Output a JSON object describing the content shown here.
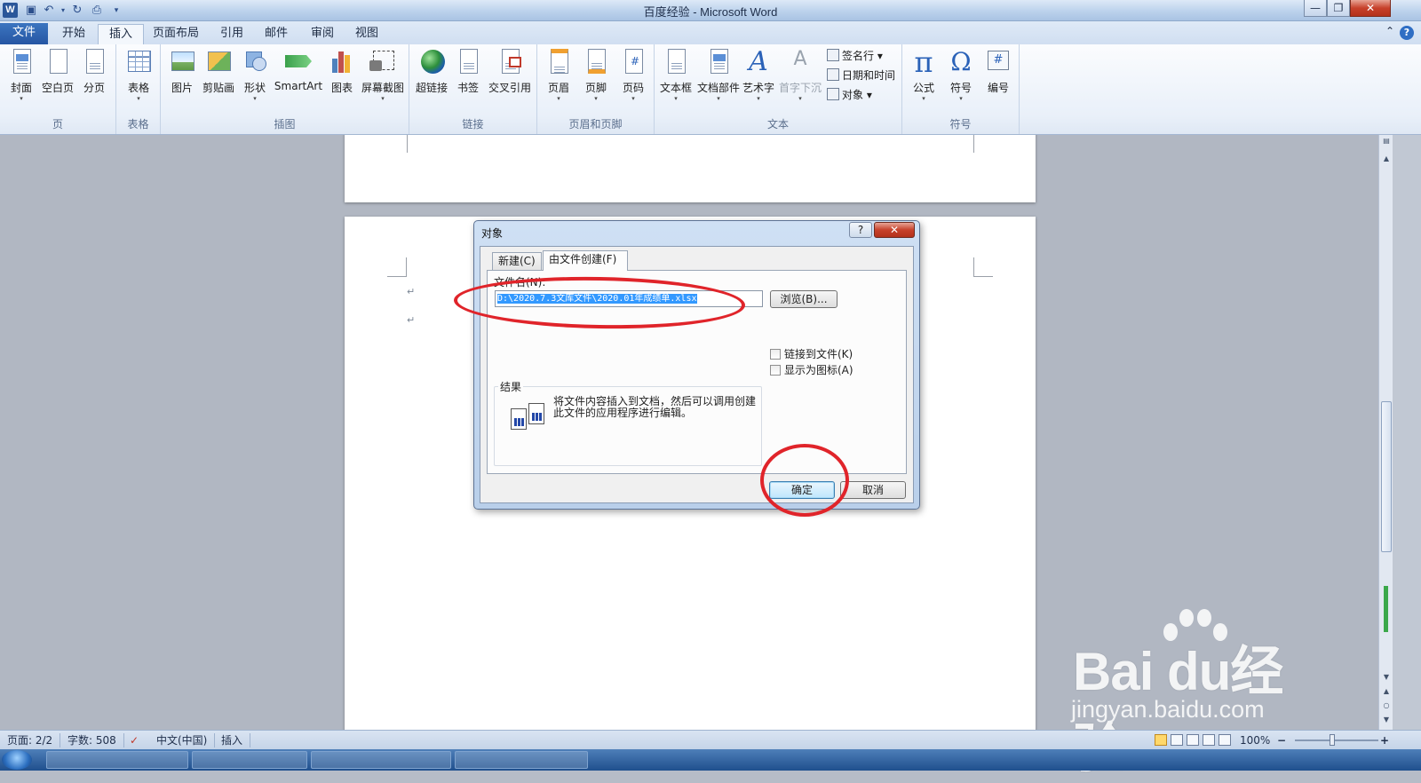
{
  "window": {
    "title": "百度经验 - Microsoft Word",
    "minimize_glyph": "—",
    "maximize_glyph": "❐",
    "close_glyph": "✕",
    "quick_access": {
      "save_icon": "save-icon",
      "undo_icon": "undo-icon",
      "redo_icon": "redo-icon",
      "print_preview_icon": "print-preview-icon",
      "customize_icon": "customize-icon"
    }
  },
  "tabs": [
    {
      "label": "文件"
    },
    {
      "label": "开始"
    },
    {
      "label": "插入"
    },
    {
      "label": "页面布局"
    },
    {
      "label": "引用"
    },
    {
      "label": "邮件"
    },
    {
      "label": "审阅"
    },
    {
      "label": "视图"
    }
  ],
  "tab_help_glyph": "?",
  "tab_minimize_glyph": "⌃",
  "ribbon": {
    "groups": [
      {
        "label": "页",
        "items": [
          "封面",
          "空白页",
          "分页"
        ]
      },
      {
        "label": "表格",
        "items": [
          "表格"
        ]
      },
      {
        "label": "插图",
        "items": [
          "图片",
          "剪贴画",
          "形状",
          "SmartArt",
          "图表",
          "屏幕截图"
        ]
      },
      {
        "label": "链接",
        "items": [
          "超链接",
          "书签",
          "交叉引用"
        ]
      },
      {
        "label": "页眉和页脚",
        "items": [
          "页眉",
          "页脚",
          "页码"
        ]
      },
      {
        "label": "文本",
        "items": [
          "文本框",
          "文档部件",
          "艺术字",
          "首字下沉"
        ],
        "small_items": [
          "签名行 ▾",
          "日期和时间",
          "对象 ▾"
        ]
      },
      {
        "label": "符号",
        "items": [
          "公式",
          "符号",
          "编号"
        ]
      }
    ],
    "dropdown_arrow": "▾",
    "symbol_glyphs": {
      "pi": "π",
      "omega": "Ω",
      "number": "#",
      "wordart": "A",
      "dropcap": "A"
    }
  },
  "document": {
    "paragraph_mark": "↵"
  },
  "dialog": {
    "title": "对象",
    "help_glyph": "?",
    "close_glyph": "✕",
    "tabs": [
      {
        "label": "新建(C)"
      },
      {
        "label": "由文件创建(F)"
      }
    ],
    "file_name_label": "文件名(N):",
    "file_name_value": "D:\\2020.7.3文库文件\\2020.01年成绩单.xlsx",
    "browse_label": "浏览(B)...",
    "checkboxes": [
      {
        "label": "链接到文件(K)",
        "checked": false
      },
      {
        "label": "显示为图标(A)",
        "checked": false
      }
    ],
    "result_label": "结果",
    "result_text": "将文件内容插入到文档，然后可以调用创建此文件的应用程序进行编辑。",
    "ok_label": "确定",
    "cancel_label": "取消"
  },
  "annotations": {
    "color": "#e0242a"
  },
  "watermark": {
    "logo_text": "Bai  du经验",
    "url": "jingyan.baidu.com"
  },
  "statusbar": {
    "page": "页面: 2/2",
    "words": "字数: 508",
    "language": "中文(中国)",
    "mode": "插入",
    "zoom": "100%",
    "zoom_out": "−",
    "zoom_in": "+",
    "zoom_level_fraction": 0.5
  },
  "colors": {
    "accent": "#2b579a",
    "file_tab": "#2656a3",
    "selection": "#3399ff"
  }
}
